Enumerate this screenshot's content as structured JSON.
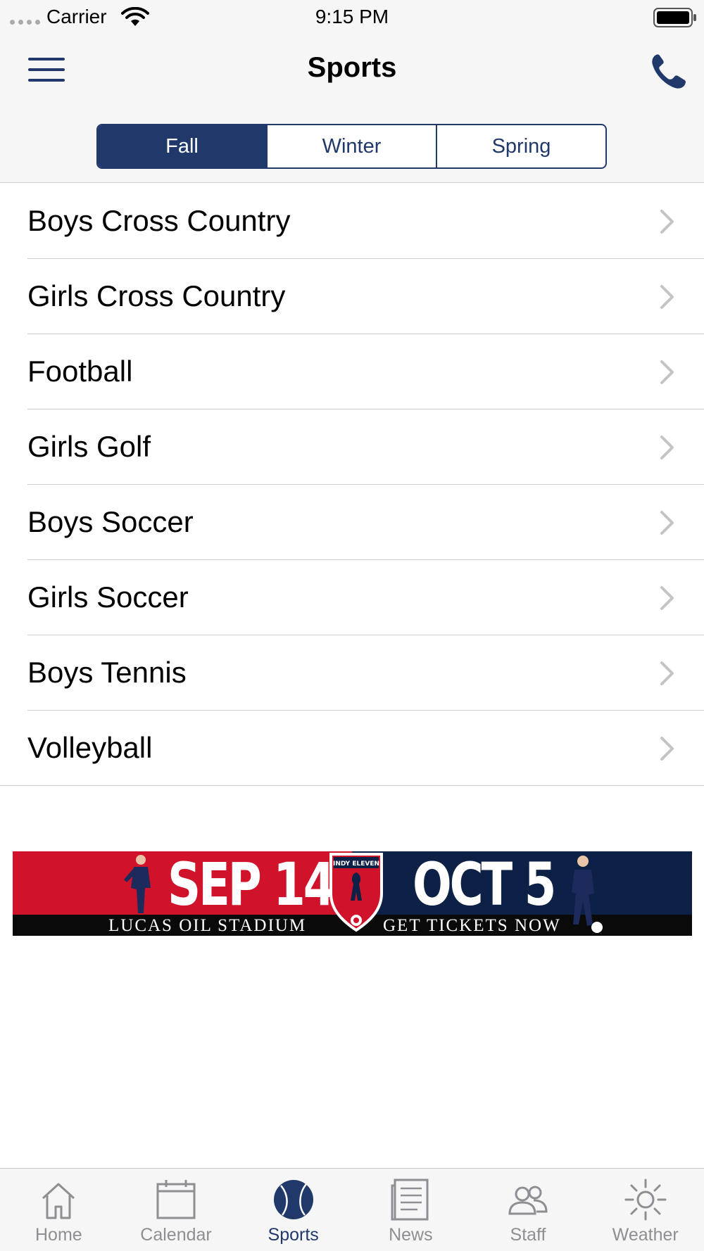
{
  "status_bar": {
    "carrier": "Carrier",
    "time": "9:15 PM"
  },
  "nav": {
    "title": "Sports",
    "left_icon": "hamburger-menu-icon",
    "right_icon": "phone-icon"
  },
  "segments": {
    "items": [
      "Fall",
      "Winter",
      "Spring"
    ],
    "selected": "Fall"
  },
  "sports": [
    "Boys Cross Country",
    "Girls Cross Country",
    "Football",
    "Girls Golf",
    "Boys Soccer",
    "Girls Soccer",
    "Boys Tennis",
    "Volleyball"
  ],
  "ad": {
    "date_left": "SEP 14",
    "date_right": "OCT 5",
    "venue": "LUCAS OIL STADIUM",
    "cta": "GET TICKETS NOW",
    "crest_text": "INDY ELEVEN"
  },
  "tabs": [
    {
      "label": "Home",
      "icon": "home-icon"
    },
    {
      "label": "Calendar",
      "icon": "calendar-icon"
    },
    {
      "label": "Sports",
      "icon": "sports-ball-icon",
      "active": true
    },
    {
      "label": "News",
      "icon": "news-icon"
    },
    {
      "label": "Staff",
      "icon": "staff-icon"
    },
    {
      "label": "Weather",
      "icon": "weather-sun-icon"
    }
  ],
  "colors": {
    "accent": "#21386b",
    "inactive": "#8e8e93",
    "ad_red": "#d1122b",
    "ad_navy": "#0d2046"
  }
}
